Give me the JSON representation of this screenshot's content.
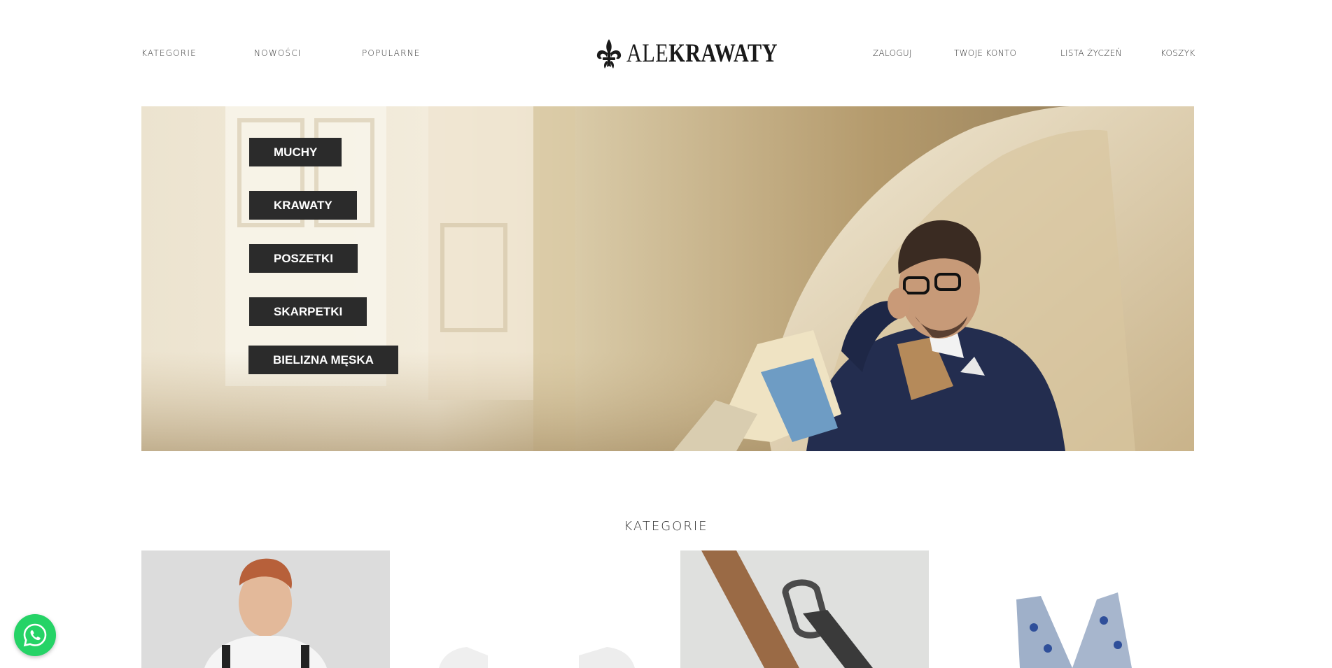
{
  "header": {
    "left_nav": [
      {
        "label": "KATEGORIE"
      },
      {
        "label": "NOWOŚCI"
      },
      {
        "label": "POPULARNE"
      }
    ],
    "logo": {
      "text_light": "ALE",
      "text_bold": "KRAWATY"
    },
    "right_nav": [
      {
        "label": "ZALOGUJ"
      },
      {
        "label": "TWOJE KONTO"
      },
      {
        "label": "LISTA ŻYCZEŃ"
      },
      {
        "label": "KOSZYK"
      }
    ]
  },
  "hero": {
    "buttons": [
      {
        "label": "MUCHY"
      },
      {
        "label": "KRAWATY"
      },
      {
        "label": "POSZETKI"
      },
      {
        "label": "SKARPETKI"
      },
      {
        "label": "BIELIZNA MĘSKA"
      }
    ]
  },
  "categories": {
    "title": "KATEGORIE"
  },
  "icons": {
    "logo": "fleur-de-lis-icon",
    "chat": "whatsapp-icon"
  },
  "colors": {
    "button_bg": "#2b2b2b",
    "whatsapp": "#25d366",
    "text": "#333333"
  }
}
